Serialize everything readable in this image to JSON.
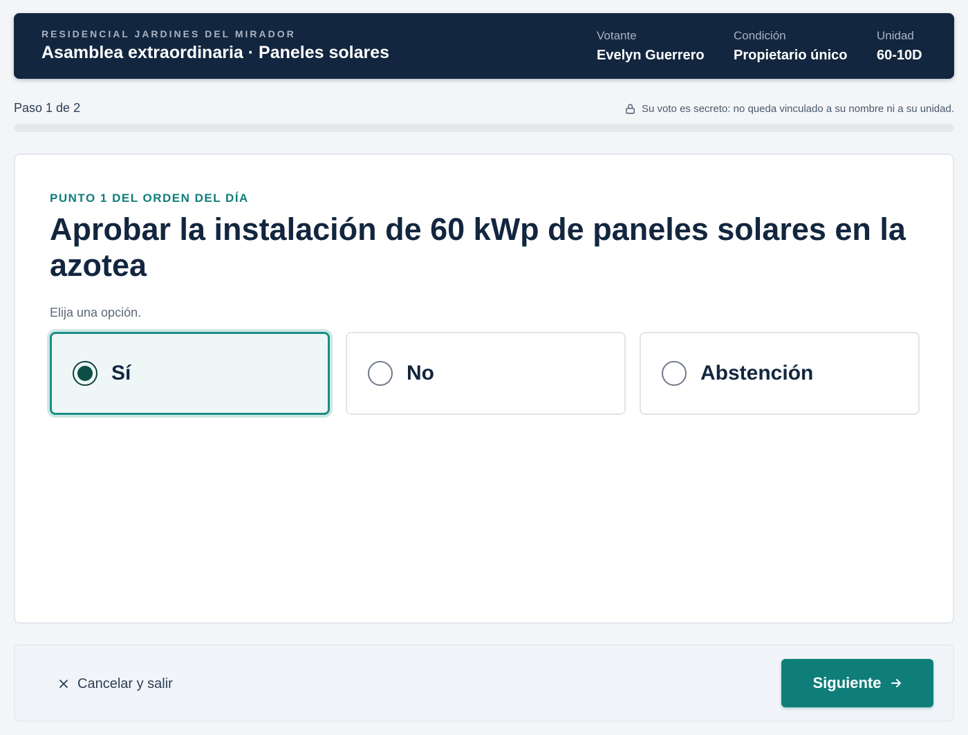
{
  "header": {
    "organization": "RESIDENCIAL JARDINES DEL MIRADOR",
    "title": "Asamblea extraordinaria · Paneles solares",
    "voter_label": "Votante",
    "voter_value": "Evelyn Guerrero",
    "condition_label": "Condición",
    "condition_value": "Propietario único",
    "unit_label": "Unidad",
    "unit_value": "60-10D"
  },
  "progress": {
    "step_text": "Paso 1 de 2",
    "fraction": 0,
    "secret_notice": "Su voto es secreto: no queda vinculado a su nombre ni a su unidad."
  },
  "ballot": {
    "item_label": "PUNTO 1 DEL ORDEN DEL DÍA",
    "question": "Aprobar la instalación de 60 kWp de paneles solares en la azotea",
    "hint": "Elija una opción.",
    "options": [
      {
        "label": "Sí",
        "selected": true
      },
      {
        "label": "No",
        "selected": false
      },
      {
        "label": "Abstención",
        "selected": false
      }
    ]
  },
  "footer": {
    "cancel_label": "Cancelar y salir",
    "next_label": "Siguiente"
  },
  "icons": {
    "lock": "lock-icon",
    "close": "close-icon",
    "arrow": "arrow-right-icon"
  },
  "colors": {
    "header_bg": "#13263f",
    "accent": "#0f7e79",
    "selected_border": "#1a8f86"
  }
}
